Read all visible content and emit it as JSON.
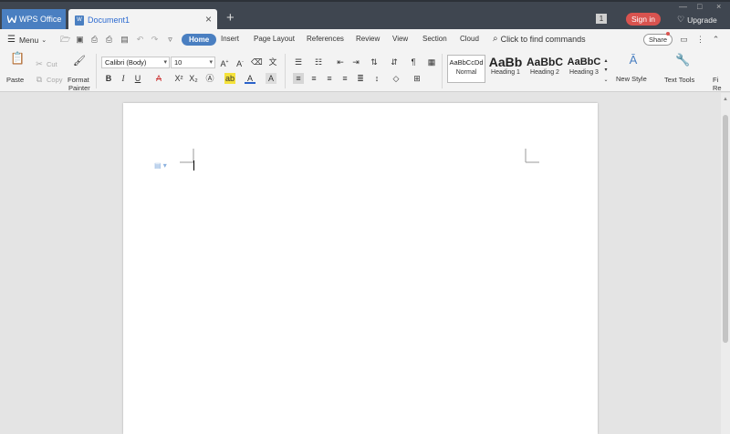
{
  "titlebar": {
    "app_tab": "WPS Office",
    "doc_tab": "Document1",
    "new_tab_icon": "+",
    "badge": "1",
    "signin": "Sign in",
    "upgrade": "Upgrade"
  },
  "menu": {
    "menu_label": "Menu",
    "tabs": [
      "Home",
      "Insert",
      "Page Layout",
      "References",
      "Review",
      "View",
      "Section",
      "Cloud"
    ],
    "active_tab": "Home",
    "find": "Click to find commands",
    "share": "Share"
  },
  "ribbon": {
    "paste": "Paste",
    "cut": "Cut",
    "copy": "Copy",
    "format_painter_1": "Format",
    "format_painter_2": "Painter",
    "font_name": "Calibri (Body)",
    "font_size": "10",
    "styles": [
      {
        "sample": "AaBbCcDd",
        "name": "Normal"
      },
      {
        "sample": "AaBb",
        "name": "Heading 1"
      },
      {
        "sample": "AaBbC",
        "name": "Heading 2"
      },
      {
        "sample": "AaBbC",
        "name": "Heading 3"
      }
    ],
    "new_style": "New Style",
    "text_tools": "Text Tools",
    "find_replace_1": "Fi",
    "find_replace_2": "Re"
  },
  "colors": {
    "accent": "#4a7fc1",
    "titlebar": "#3f4650",
    "signin": "#d9534f"
  }
}
